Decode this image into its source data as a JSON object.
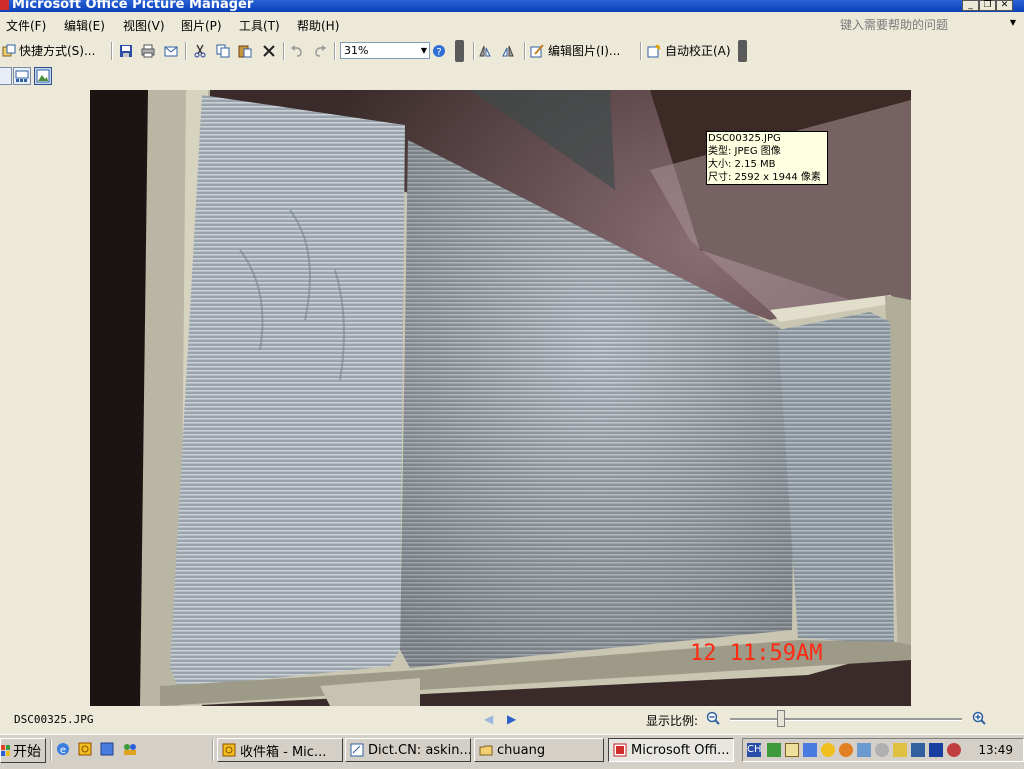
{
  "window": {
    "title": "Microsoft Office Picture Manager"
  },
  "menu": {
    "items": [
      "文件(F)",
      "编辑(E)",
      "视图(V)",
      "图片(P)",
      "工具(T)",
      "帮助(H)"
    ],
    "help_placeholder": "键入需要帮助的问题"
  },
  "toolbar": {
    "shortcuts_label": "快捷方式(S)...",
    "zoom_value": "31%",
    "edit_pictures_label": "编辑图片(I)...",
    "auto_correct_label": "自动校正(A)"
  },
  "tooltip": {
    "filename": "DSC00325.JPG",
    "type": "类型: JPEG 图像",
    "size": "大小: 2.15 MB",
    "dimensions": "尺寸: 2592 x 1944 像素"
  },
  "photo": {
    "timestamp": "12 11:59AM"
  },
  "status": {
    "filename": "DSC00325.JPG",
    "zoom_label": "显示比例:",
    "zoom_slider_fraction": 0.22
  },
  "taskbar": {
    "start_label": "开始",
    "tasks": [
      "收件箱 - Mic...",
      "Dict.CN: askin...",
      "chuang",
      "Microsoft Offi..."
    ],
    "clock": "13:49"
  },
  "colors": {
    "titlebar": "#0a3fb8",
    "chrome": "#ece9d8",
    "tooltip_bg": "#ffffe1",
    "photo_timestamp": "#ff2a10"
  }
}
